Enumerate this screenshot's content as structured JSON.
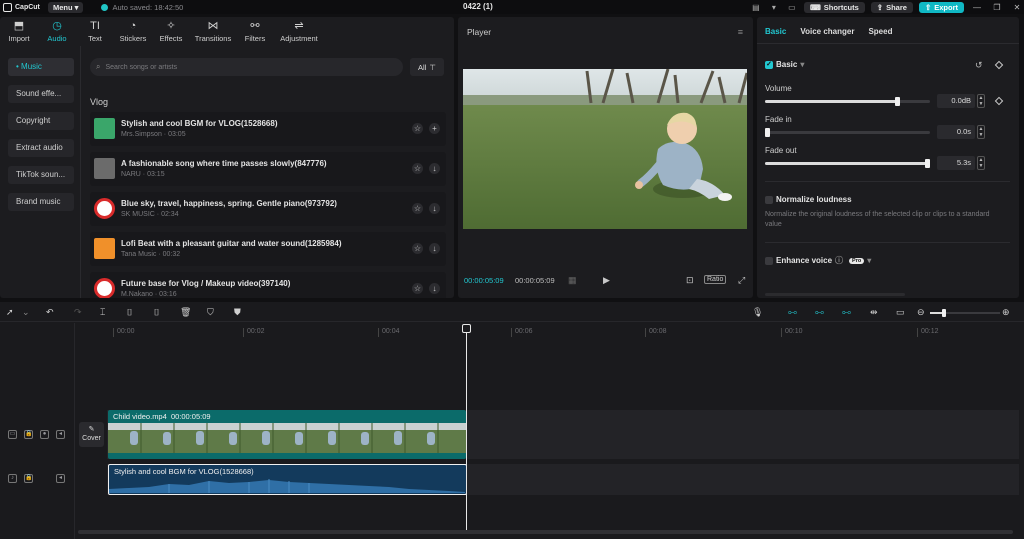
{
  "titlebar": {
    "app_name": "CapCut",
    "menu_label": "Menu",
    "autosave": "Auto saved: 18:42:50",
    "project": "0422 (1)",
    "shortcuts": "Shortcuts",
    "share": "Share",
    "export": "Export"
  },
  "media_tabs": [
    {
      "label": "Import",
      "icon": "import-icon"
    },
    {
      "label": "Audio",
      "icon": "audio-icon"
    },
    {
      "label": "Text",
      "icon": "text-icon"
    },
    {
      "label": "Stickers",
      "icon": "stickers-icon"
    },
    {
      "label": "Effects",
      "icon": "effects-icon"
    },
    {
      "label": "Transitions",
      "icon": "transitions-icon"
    },
    {
      "label": "Filters",
      "icon": "filters-icon"
    },
    {
      "label": "Adjustment",
      "icon": "adjustment-icon"
    }
  ],
  "audio_categories": [
    "Music",
    "Sound effe...",
    "Copyright",
    "Extract audio",
    "TikTok soun...",
    "Brand music"
  ],
  "search": {
    "placeholder": "Search songs or artists",
    "filter_label": "All"
  },
  "section_label": "Vlog",
  "tracks": [
    {
      "title": "Stylish and cool BGM for VLOG(1528668)",
      "artist": "Mrs.Simpson",
      "duration": "03:05",
      "thumb_color": "#3aa66a",
      "action": "add"
    },
    {
      "title": "A fashionable song where time passes slowly(847776)",
      "artist": "NARU",
      "duration": "03:15",
      "thumb_color": "#6b6b6b",
      "action": "download"
    },
    {
      "title": "Blue sky, travel, happiness, spring. Gentle piano(973792)",
      "artist": "SK MUSIC",
      "duration": "02:34",
      "thumb_color": "#d92b2b",
      "action": "download"
    },
    {
      "title": "Lofi Beat with a pleasant guitar and water sound(1285984)",
      "artist": "Tana Music",
      "duration": "00:32",
      "thumb_color": "#f0902a",
      "action": "download"
    },
    {
      "title": "Future base for Vlog / Makeup video(397140)",
      "artist": "M.Nakano",
      "duration": "03:16",
      "thumb_color": "#d92b2b",
      "action": "download"
    }
  ],
  "player": {
    "title": "Player",
    "current_time": "00:00:05:09",
    "total_time": "00:00:05:09",
    "ratio_label": "Ratio"
  },
  "props": {
    "tabs": [
      "Basic",
      "Voice changer",
      "Speed"
    ],
    "basic_label": "Basic",
    "volume": {
      "label": "Volume",
      "value": "0.0dB",
      "level": 0.8
    },
    "fade_in": {
      "label": "Fade in",
      "value": "0.0s",
      "level": 0.0
    },
    "fade_out": {
      "label": "Fade out",
      "value": "5.3s",
      "level": 1.0
    },
    "normalize": {
      "label": "Normalize loudness",
      "desc": "Normalize the original loudness of the selected clip or clips to a standard value"
    },
    "enhance": {
      "label": "Enhance voice",
      "badge": "Pro"
    }
  },
  "timeline": {
    "ticks": [
      "00:00",
      "00:02",
      "00:04",
      "00:06",
      "00:08",
      "00:10",
      "00:12"
    ],
    "cover_label": "Cover",
    "video_clip": {
      "name": "Child video.mp4",
      "duration": "00:00:05:09"
    },
    "audio_clip": {
      "name": "Stylish and cool BGM for VLOG(1528668)"
    }
  }
}
